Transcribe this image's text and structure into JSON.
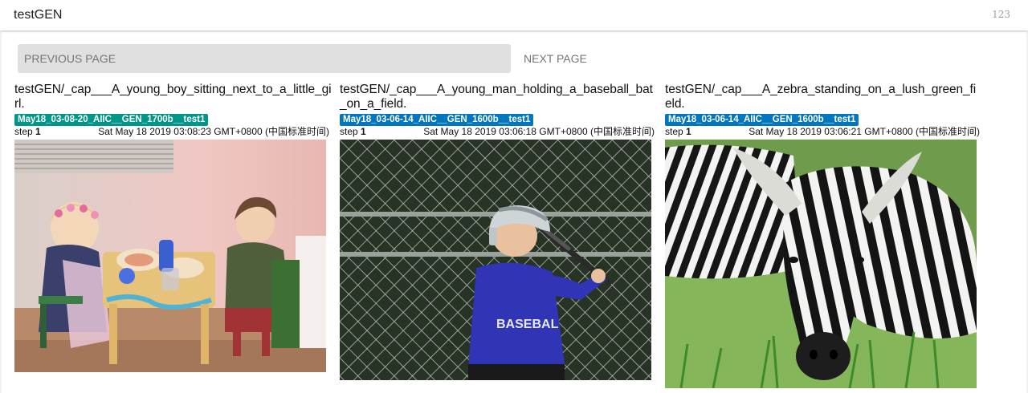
{
  "header": {
    "title": "testGEN",
    "count": "123"
  },
  "pagination": {
    "previous_label": "PREVIOUS PAGE",
    "next_label": "NEXT PAGE"
  },
  "step_label": "step",
  "cards": [
    {
      "title": "testGEN/_cap___A_young_boy_sitting_next_to_a_little_girl.",
      "run": "May18_03-08-20_AIIC__GEN_1700b__test1",
      "badge_color": "#009688",
      "step": "1",
      "timestamp": "Sat May 18 2019 03:08:23 GMT+0800 (中国标准时间)",
      "image_subject": "children-at-table"
    },
    {
      "title": "testGEN/_cap___A_young_man_holding_a_baseball_bat_on_a_field.",
      "run": "May18_03-06-14_AIIC__GEN_1600b__test1",
      "badge_color": "#0277bd",
      "step": "1",
      "timestamp": "Sat May 18 2019 03:06:18 GMT+0800 (中国标准时间)",
      "image_subject": "boy-batting"
    },
    {
      "title": "testGEN/_cap___A_zebra_standing_on_a_lush_green_field.",
      "run": "May18_03-06-14_AIIC__GEN_1600b__test1",
      "badge_color": "#0277bd",
      "step": "1",
      "timestamp": "Sat May 18 2019 03:06:21 GMT+0800 (中国标准时间)",
      "image_subject": "zebra-grazing"
    }
  ]
}
